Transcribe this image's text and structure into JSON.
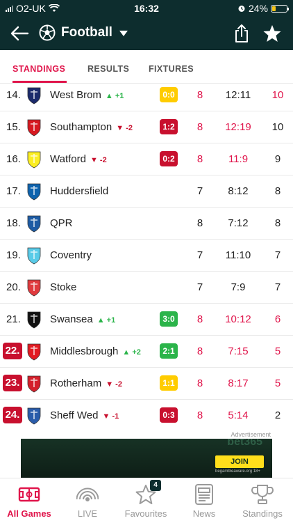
{
  "status_bar": {
    "carrier": "O2-UK",
    "time": "16:32",
    "battery": "24%",
    "battery_level": 0.24
  },
  "header": {
    "title": "Football"
  },
  "tabs": [
    {
      "label": "STANDINGS",
      "active": true
    },
    {
      "label": "RESULTS",
      "active": false
    },
    {
      "label": "FIXTURES",
      "active": false
    }
  ],
  "table": {
    "rows": [
      {
        "pos": "14.",
        "team": "West Brom",
        "move": "+1",
        "move_dir": "up",
        "live": "0:0",
        "live_state": "draw",
        "played": "8",
        "gd": "12:11",
        "pts": "10",
        "crest_color": "#1b2a6b",
        "played_hl": true,
        "gd_hl": false,
        "pts_hl": true
      },
      {
        "pos": "15.",
        "team": "Southampton",
        "move": "-2",
        "move_dir": "down",
        "live": "1:2",
        "live_state": "lose",
        "played": "8",
        "gd": "12:19",
        "pts": "10",
        "crest_color": "#d71920",
        "played_hl": true,
        "gd_hl": true,
        "pts_hl": false
      },
      {
        "pos": "16.",
        "team": "Watford",
        "move": "-2",
        "move_dir": "down",
        "live": "0:2",
        "live_state": "lose",
        "played": "8",
        "gd": "11:9",
        "pts": "9",
        "crest_color": "#fbee23",
        "played_hl": true,
        "gd_hl": true,
        "pts_hl": false
      },
      {
        "pos": "17.",
        "team": "Huddersfield",
        "move": "",
        "move_dir": "",
        "live": "",
        "live_state": "",
        "played": "7",
        "gd": "8:12",
        "pts": "8",
        "crest_color": "#0e63ad",
        "played_hl": false,
        "gd_hl": false,
        "pts_hl": false
      },
      {
        "pos": "18.",
        "team": "QPR",
        "move": "",
        "move_dir": "",
        "live": "",
        "live_state": "",
        "played": "8",
        "gd": "7:12",
        "pts": "8",
        "crest_color": "#1d5ba4",
        "played_hl": false,
        "gd_hl": false,
        "pts_hl": false
      },
      {
        "pos": "19.",
        "team": "Coventry",
        "move": "",
        "move_dir": "",
        "live": "",
        "live_state": "",
        "played": "7",
        "gd": "11:10",
        "pts": "7",
        "crest_color": "#59cbe8",
        "played_hl": false,
        "gd_hl": false,
        "pts_hl": false
      },
      {
        "pos": "20.",
        "team": "Stoke",
        "move": "",
        "move_dir": "",
        "live": "",
        "live_state": "",
        "played": "7",
        "gd": "7:9",
        "pts": "7",
        "crest_color": "#e03a3e",
        "played_hl": false,
        "gd_hl": false,
        "pts_hl": false
      },
      {
        "pos": "21.",
        "team": "Swansea",
        "move": "+1",
        "move_dir": "up",
        "live": "3:0",
        "live_state": "win",
        "played": "8",
        "gd": "10:12",
        "pts": "6",
        "crest_color": "#111111",
        "played_hl": true,
        "gd_hl": true,
        "pts_hl": true
      },
      {
        "pos": "22.",
        "team": "Middlesbrough",
        "move": "+2",
        "move_dir": "up",
        "live": "2:1",
        "live_state": "win",
        "played": "8",
        "gd": "7:15",
        "pts": "5",
        "crest_color": "#e21b22",
        "played_hl": true,
        "gd_hl": true,
        "pts_hl": true,
        "relegation": true
      },
      {
        "pos": "23.",
        "team": "Rotherham",
        "move": "-2",
        "move_dir": "down",
        "live": "1:1",
        "live_state": "draw",
        "played": "8",
        "gd": "8:17",
        "pts": "5",
        "crest_color": "#d4202b",
        "played_hl": true,
        "gd_hl": true,
        "pts_hl": true,
        "relegation": true
      },
      {
        "pos": "24.",
        "team": "Sheff Wed",
        "move": "-1",
        "move_dir": "down",
        "live": "0:3",
        "live_state": "lose",
        "played": "8",
        "gd": "5:14",
        "pts": "2",
        "crest_color": "#2a5caa",
        "played_hl": true,
        "gd_hl": true,
        "pts_hl": false,
        "relegation": true
      }
    ]
  },
  "ad": {
    "label": "Advertisement",
    "brand": "bet365",
    "cta": "JOIN",
    "fine_print": "begambleaware.org 18+"
  },
  "bottom_nav": [
    {
      "label": "All Games",
      "icon": "pitch-icon",
      "active": true
    },
    {
      "label": "LIVE",
      "icon": "live-broadcast-icon",
      "active": false
    },
    {
      "label": "Favourites",
      "icon": "star-outline-icon",
      "active": false,
      "badge": "4"
    },
    {
      "label": "News",
      "icon": "newspaper-icon",
      "active": false
    },
    {
      "label": "Standings",
      "icon": "trophy-icon",
      "active": false
    }
  ]
}
